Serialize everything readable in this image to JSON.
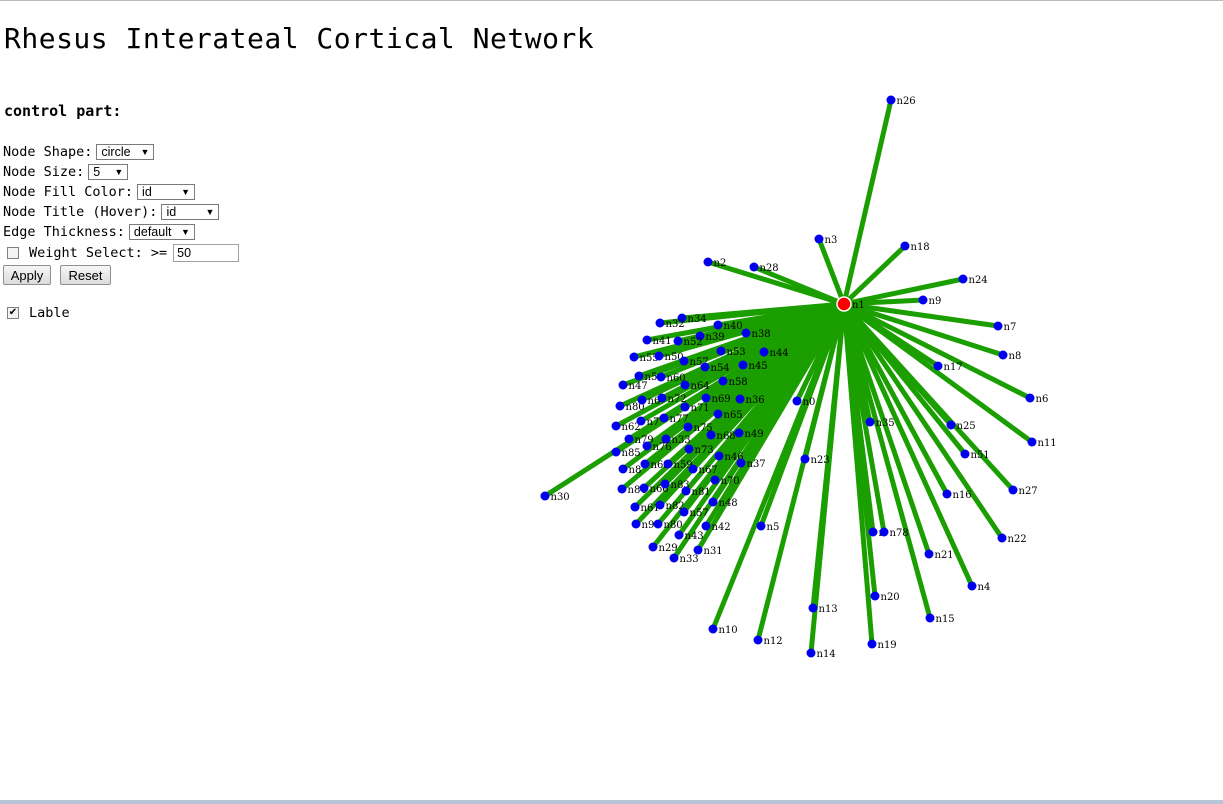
{
  "page": {
    "title": "Rhesus Interateal Cortical Network"
  },
  "controls": {
    "heading": "control part:",
    "node_shape": {
      "label": "Node Shape:",
      "value": "circle"
    },
    "node_size": {
      "label": "Node Size:",
      "value": "5"
    },
    "node_fill": {
      "label": "Node Fill Color:",
      "value": "id"
    },
    "node_title": {
      "label": "Node Title (Hover):",
      "value": "id"
    },
    "edge_thickness": {
      "label": "Edge Thickness:",
      "value": "default"
    },
    "weight_select": {
      "label": "Weight Select: >=",
      "value": "50",
      "checked": false
    },
    "apply_label": "Apply",
    "reset_label": "Reset",
    "lable": {
      "label": "Lable",
      "checked": true
    }
  },
  "graph": {
    "edge_color": "#1a9e00",
    "node_color": "#0000ee",
    "hub_color": "#ff0000",
    "hub": "n1",
    "nodes": [
      {
        "id": "n26"
      },
      {
        "id": "n3"
      },
      {
        "id": "n18"
      },
      {
        "id": "n2"
      },
      {
        "id": "n28"
      },
      {
        "id": "n24"
      },
      {
        "id": "n9"
      },
      {
        "id": "n7"
      },
      {
        "id": "n8"
      },
      {
        "id": "n17"
      },
      {
        "id": "n6"
      },
      {
        "id": "n0"
      },
      {
        "id": "n35"
      },
      {
        "id": "n25"
      },
      {
        "id": "n11"
      },
      {
        "id": "n51"
      },
      {
        "id": "n23"
      },
      {
        "id": "n27"
      },
      {
        "id": "n16"
      },
      {
        "id": "n22"
      },
      {
        "id": "n5"
      },
      {
        "id": "n1_"
      },
      {
        "id": "n78"
      },
      {
        "id": "n21"
      },
      {
        "id": "n4"
      },
      {
        "id": "n20"
      },
      {
        "id": "n13"
      },
      {
        "id": "n15"
      },
      {
        "id": "n10"
      },
      {
        "id": "n12"
      },
      {
        "id": "n19"
      },
      {
        "id": "n14"
      },
      {
        "id": "n30"
      },
      {
        "id": "n34"
      },
      {
        "id": "n32"
      },
      {
        "id": "n40"
      },
      {
        "id": "n39"
      },
      {
        "id": "n38"
      },
      {
        "id": "n41"
      },
      {
        "id": "n52"
      },
      {
        "id": "n53"
      },
      {
        "id": "n44"
      },
      {
        "id": "n55"
      },
      {
        "id": "n50"
      },
      {
        "id": "n57"
      },
      {
        "id": "n45"
      },
      {
        "id": "n54"
      },
      {
        "id": "n5x"
      },
      {
        "id": "n60"
      },
      {
        "id": "n58"
      },
      {
        "id": "n47"
      },
      {
        "id": "n64"
      },
      {
        "id": "n69"
      },
      {
        "id": "n36"
      },
      {
        "id": "n80"
      },
      {
        "id": "n6x"
      },
      {
        "id": "n72"
      },
      {
        "id": "n71"
      },
      {
        "id": "n65"
      },
      {
        "id": "n62"
      },
      {
        "id": "n7x"
      },
      {
        "id": "n77"
      },
      {
        "id": "n75"
      },
      {
        "id": "n79"
      },
      {
        "id": "n68"
      },
      {
        "id": "n49"
      },
      {
        "id": "n33x"
      },
      {
        "id": "n76"
      },
      {
        "id": "n73"
      },
      {
        "id": "n85"
      },
      {
        "id": "n46"
      },
      {
        "id": "n37"
      },
      {
        "id": "n8x"
      },
      {
        "id": "n63"
      },
      {
        "id": "n59"
      },
      {
        "id": "n67"
      },
      {
        "id": "n70"
      },
      {
        "id": "n84"
      },
      {
        "id": "n66"
      },
      {
        "id": "n83"
      },
      {
        "id": "n81"
      },
      {
        "id": "n48"
      },
      {
        "id": "n61"
      },
      {
        "id": "n82"
      },
      {
        "id": "n57b"
      },
      {
        "id": "n9x"
      },
      {
        "id": "n43"
      },
      {
        "id": "n42"
      },
      {
        "id": "n86"
      },
      {
        "id": "n29"
      },
      {
        "id": "n31"
      },
      {
        "id": "n33"
      }
    ],
    "labels": {
      "n26": "n26",
      "n3": "n3",
      "n18": "n18",
      "n2": "n2",
      "n28": "n28",
      "n24": "n24",
      "n9": "n9",
      "n7": "n7",
      "n8": "n8",
      "n17": "n17",
      "n6": "n6",
      "n0": "n0",
      "n35": "n35",
      "n25": "n25",
      "n11": "n11",
      "n51": "n51",
      "n23": "n23",
      "n27": "n27",
      "n16": "n16",
      "n22": "n22",
      "n5": "n5",
      "n1_": "n",
      "n78": "n78",
      "n21": "n21",
      "n4": "n4",
      "n20": "n20",
      "n13": "n13",
      "n15": "n15",
      "n10": "n10",
      "n12": "n12",
      "n19": "n19",
      "n14": "n14",
      "n30": "n30",
      "n34": "n34",
      "n32": "n32",
      "n40": "n40",
      "n39": "n39",
      "n38": "n38",
      "n41": "n41",
      "n52": "n52",
      "n53": "n53",
      "n44": "n44",
      "n55": "n55",
      "n50": "n50",
      "n57": "n57",
      "n45": "n45",
      "n54": "n54",
      "n5x": "n5",
      "n60": "n60",
      "n58": "n58",
      "n47": "n47",
      "n64": "n64",
      "n69": "n69",
      "n36": "n36",
      "n80": "n80",
      "n6x": "n6",
      "n72": "n72",
      "n71": "n71",
      "n65": "n65",
      "n62": "n62",
      "n7x": "n7",
      "n77": "n77",
      "n75": "n75",
      "n79": "n79",
      "n68": "n68",
      "n49": "n49",
      "n33x": "n33",
      "n76": "n76",
      "n73": "n73",
      "n85": "n85",
      "n46": "n46",
      "n37": "n37",
      "n8x": "n8",
      "n63": "n63",
      "n59": "n59",
      "n67": "n67",
      "n70": "n70",
      "n84": "n84",
      "n66": "n66",
      "n83": "n83",
      "n81": "n81",
      "n48": "n48",
      "n61": "n61",
      "n82": "n82",
      "n57b": "n57",
      "n9x": "n9",
      "n43": "n43",
      "n42": "n42",
      "n86": "n80",
      "n29": "n29",
      "n31": "n31",
      "n33": "n33",
      "n1": "n1"
    }
  }
}
